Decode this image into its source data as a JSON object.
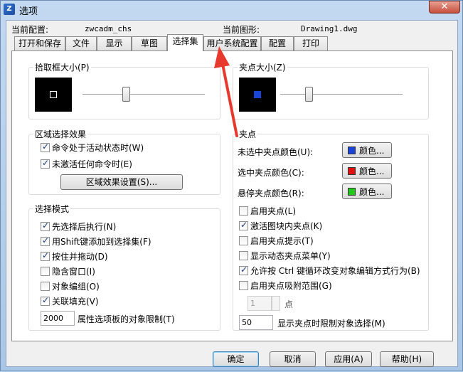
{
  "window": {
    "title": "选项",
    "close_label": "✕"
  },
  "info": {
    "current_config_label": "当前配置:",
    "current_config_value": "zwcadm_chs",
    "current_drawing_label": "当前图形:",
    "current_drawing_value": "Drawing1.dwg"
  },
  "tabs": [
    {
      "label": "打开和保存"
    },
    {
      "label": "文件"
    },
    {
      "label": "显示"
    },
    {
      "label": "草图"
    },
    {
      "label": "选择集"
    },
    {
      "label": "用户系统配置"
    },
    {
      "label": "配置"
    },
    {
      "label": "打印"
    }
  ],
  "active_tab": "选择集",
  "pickbox": {
    "title": "拾取框大小(P)",
    "slider_level": 0.35
  },
  "gripsize": {
    "title": "夹点大小(Z)",
    "slider_level": 0.22
  },
  "area_selection": {
    "title": "区域选择效果",
    "items": [
      {
        "label": "命令处于活动状态时(W)",
        "checked": true
      },
      {
        "label": "未激活任何命令时(E)",
        "checked": true
      }
    ],
    "settings_button": "区域效果设置(S)..."
  },
  "selection_modes": {
    "title": "选择模式",
    "items": [
      {
        "label": "先选择后执行(N)",
        "checked": true
      },
      {
        "label": "用Shift键添加到选择集(F)",
        "checked": true
      },
      {
        "label": "按住并拖动(D)",
        "checked": true
      },
      {
        "label": "隐含窗口(I)",
        "checked": false
      },
      {
        "label": "对象编组(O)",
        "checked": false
      },
      {
        "label": "关联填充(V)",
        "checked": true
      }
    ],
    "limit_value": "2000",
    "limit_label": "属性选项板的对象限制(T)"
  },
  "grips": {
    "title": "夹点",
    "colors": [
      {
        "label": "未选中夹点颜色(U):",
        "button": "颜色...",
        "color": "#1a43d8"
      },
      {
        "label": "选中夹点颜色(C):",
        "button": "颜色...",
        "color": "#e01010"
      },
      {
        "label": "悬停夹点颜色(R):",
        "button": "颜色...",
        "color": "#22c81c"
      }
    ],
    "items": [
      {
        "label": "启用夹点(L)",
        "checked": false
      },
      {
        "label": "激活图块内夹点(K)",
        "checked": true
      },
      {
        "label": "启用夹点提示(T)",
        "checked": false
      },
      {
        "label": "显示动态夹点菜单(Y)",
        "checked": false
      },
      {
        "label": "允许按 Ctrl 键循环改变对象编辑方式行为(B)",
        "checked": true
      },
      {
        "label": "启用夹点吸附范围(G)",
        "checked": false
      }
    ],
    "snap_value": "1",
    "snap_unit": "点",
    "limit_value": "50",
    "limit_label": "显示夹点时限制对象选择(M)"
  },
  "footer": {
    "ok": "确定",
    "cancel": "取消",
    "apply": "应用(A)",
    "help": "帮助(H)"
  },
  "colors": {
    "annotation_arrow": "#e8392e",
    "grip_preview": "#1a43d8"
  }
}
